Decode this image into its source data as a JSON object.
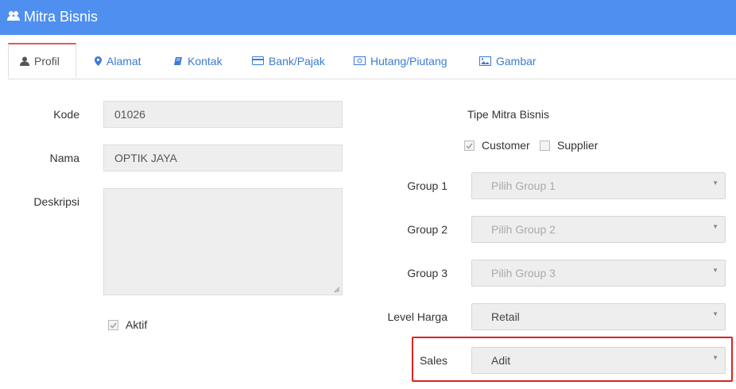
{
  "window": {
    "title": "Mitra Bisnis",
    "icon": "users-icon"
  },
  "tabs": [
    {
      "label": "Profil",
      "icon": "user-icon",
      "active": true
    },
    {
      "label": "Alamat",
      "icon": "map-marker-icon"
    },
    {
      "label": "Kontak",
      "icon": "book-icon"
    },
    {
      "label": "Bank/Pajak",
      "icon": "credit-card-icon"
    },
    {
      "label": "Hutang/Piutang",
      "icon": "money-icon"
    },
    {
      "label": "Gambar",
      "icon": "image-icon"
    }
  ],
  "form": {
    "kode": {
      "label": "Kode",
      "value": "01026"
    },
    "nama": {
      "label": "Nama",
      "value": "OPTIK JAYA"
    },
    "deskripsi": {
      "label": "Deskripsi",
      "value": ""
    },
    "aktif": {
      "label": "Aktif",
      "checked": true
    },
    "tipe": {
      "label": "Tipe Mitra Bisnis",
      "customer": {
        "label": "Customer",
        "checked": true
      },
      "supplier": {
        "label": "Supplier",
        "checked": false
      }
    },
    "group1": {
      "label": "Group 1",
      "placeholder": "Pilih Group 1"
    },
    "group2": {
      "label": "Group 2",
      "placeholder": "Pilih Group 2"
    },
    "group3": {
      "label": "Group 3",
      "placeholder": "Pilih Group 3"
    },
    "level_harga": {
      "label": "Level Harga",
      "value": "Retail"
    },
    "sales": {
      "label": "Sales",
      "value": "Adit"
    }
  },
  "colors": {
    "header": "#4f8ff0",
    "tab_link": "#3a7bd5",
    "active_tab_top": "#e05a5a",
    "highlight": "#dd2222"
  }
}
